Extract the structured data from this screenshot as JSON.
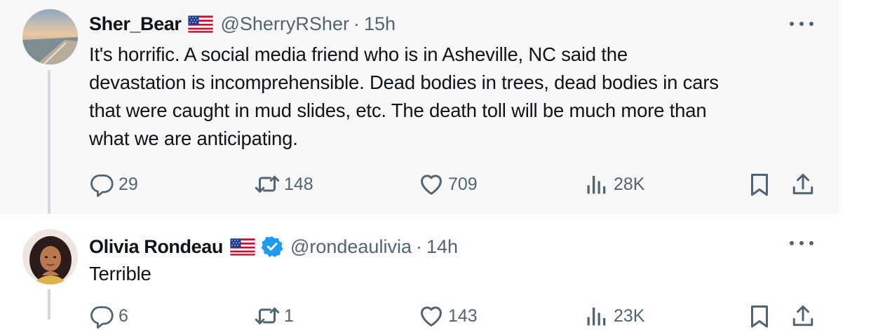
{
  "tweets": [
    {
      "name": "Sher_Bear",
      "handle": "@SherryRSher",
      "separator": "·",
      "time": "15h",
      "text_lines": [
        "It's horrific. A social media friend who is in Asheville, NC said the",
        "devastation is incomprehensible. Dead bodies in trees, dead bodies in cars",
        "that were caught in mud slides, etc. The death toll will be much more than",
        "what we are anticipating."
      ],
      "replies": "29",
      "reposts": "148",
      "likes": "709",
      "views": "28K"
    },
    {
      "name": "Olivia Rondeau",
      "handle": "@rondeaulivia",
      "separator": "·",
      "time": "14h",
      "text_lines": [
        "Terrible"
      ],
      "replies": "6",
      "reposts": "1",
      "likes": "143",
      "views": "23K"
    }
  ],
  "icons": {
    "reply": "speech-bubble-icon",
    "repost": "repost-arrows-icon",
    "like": "heart-icon",
    "views": "bar-chart-icon",
    "bookmark": "bookmark-icon",
    "share": "share-upload-icon",
    "flag": "us-flag-icon",
    "verified": "verified-badge-icon",
    "more": "more-dots-icon"
  },
  "colors": {
    "secondary_text": "#536471",
    "verified_blue": "#1d9bf0",
    "thread_line": "#cfd9de",
    "highlight_bg": "#f7f7f7"
  }
}
